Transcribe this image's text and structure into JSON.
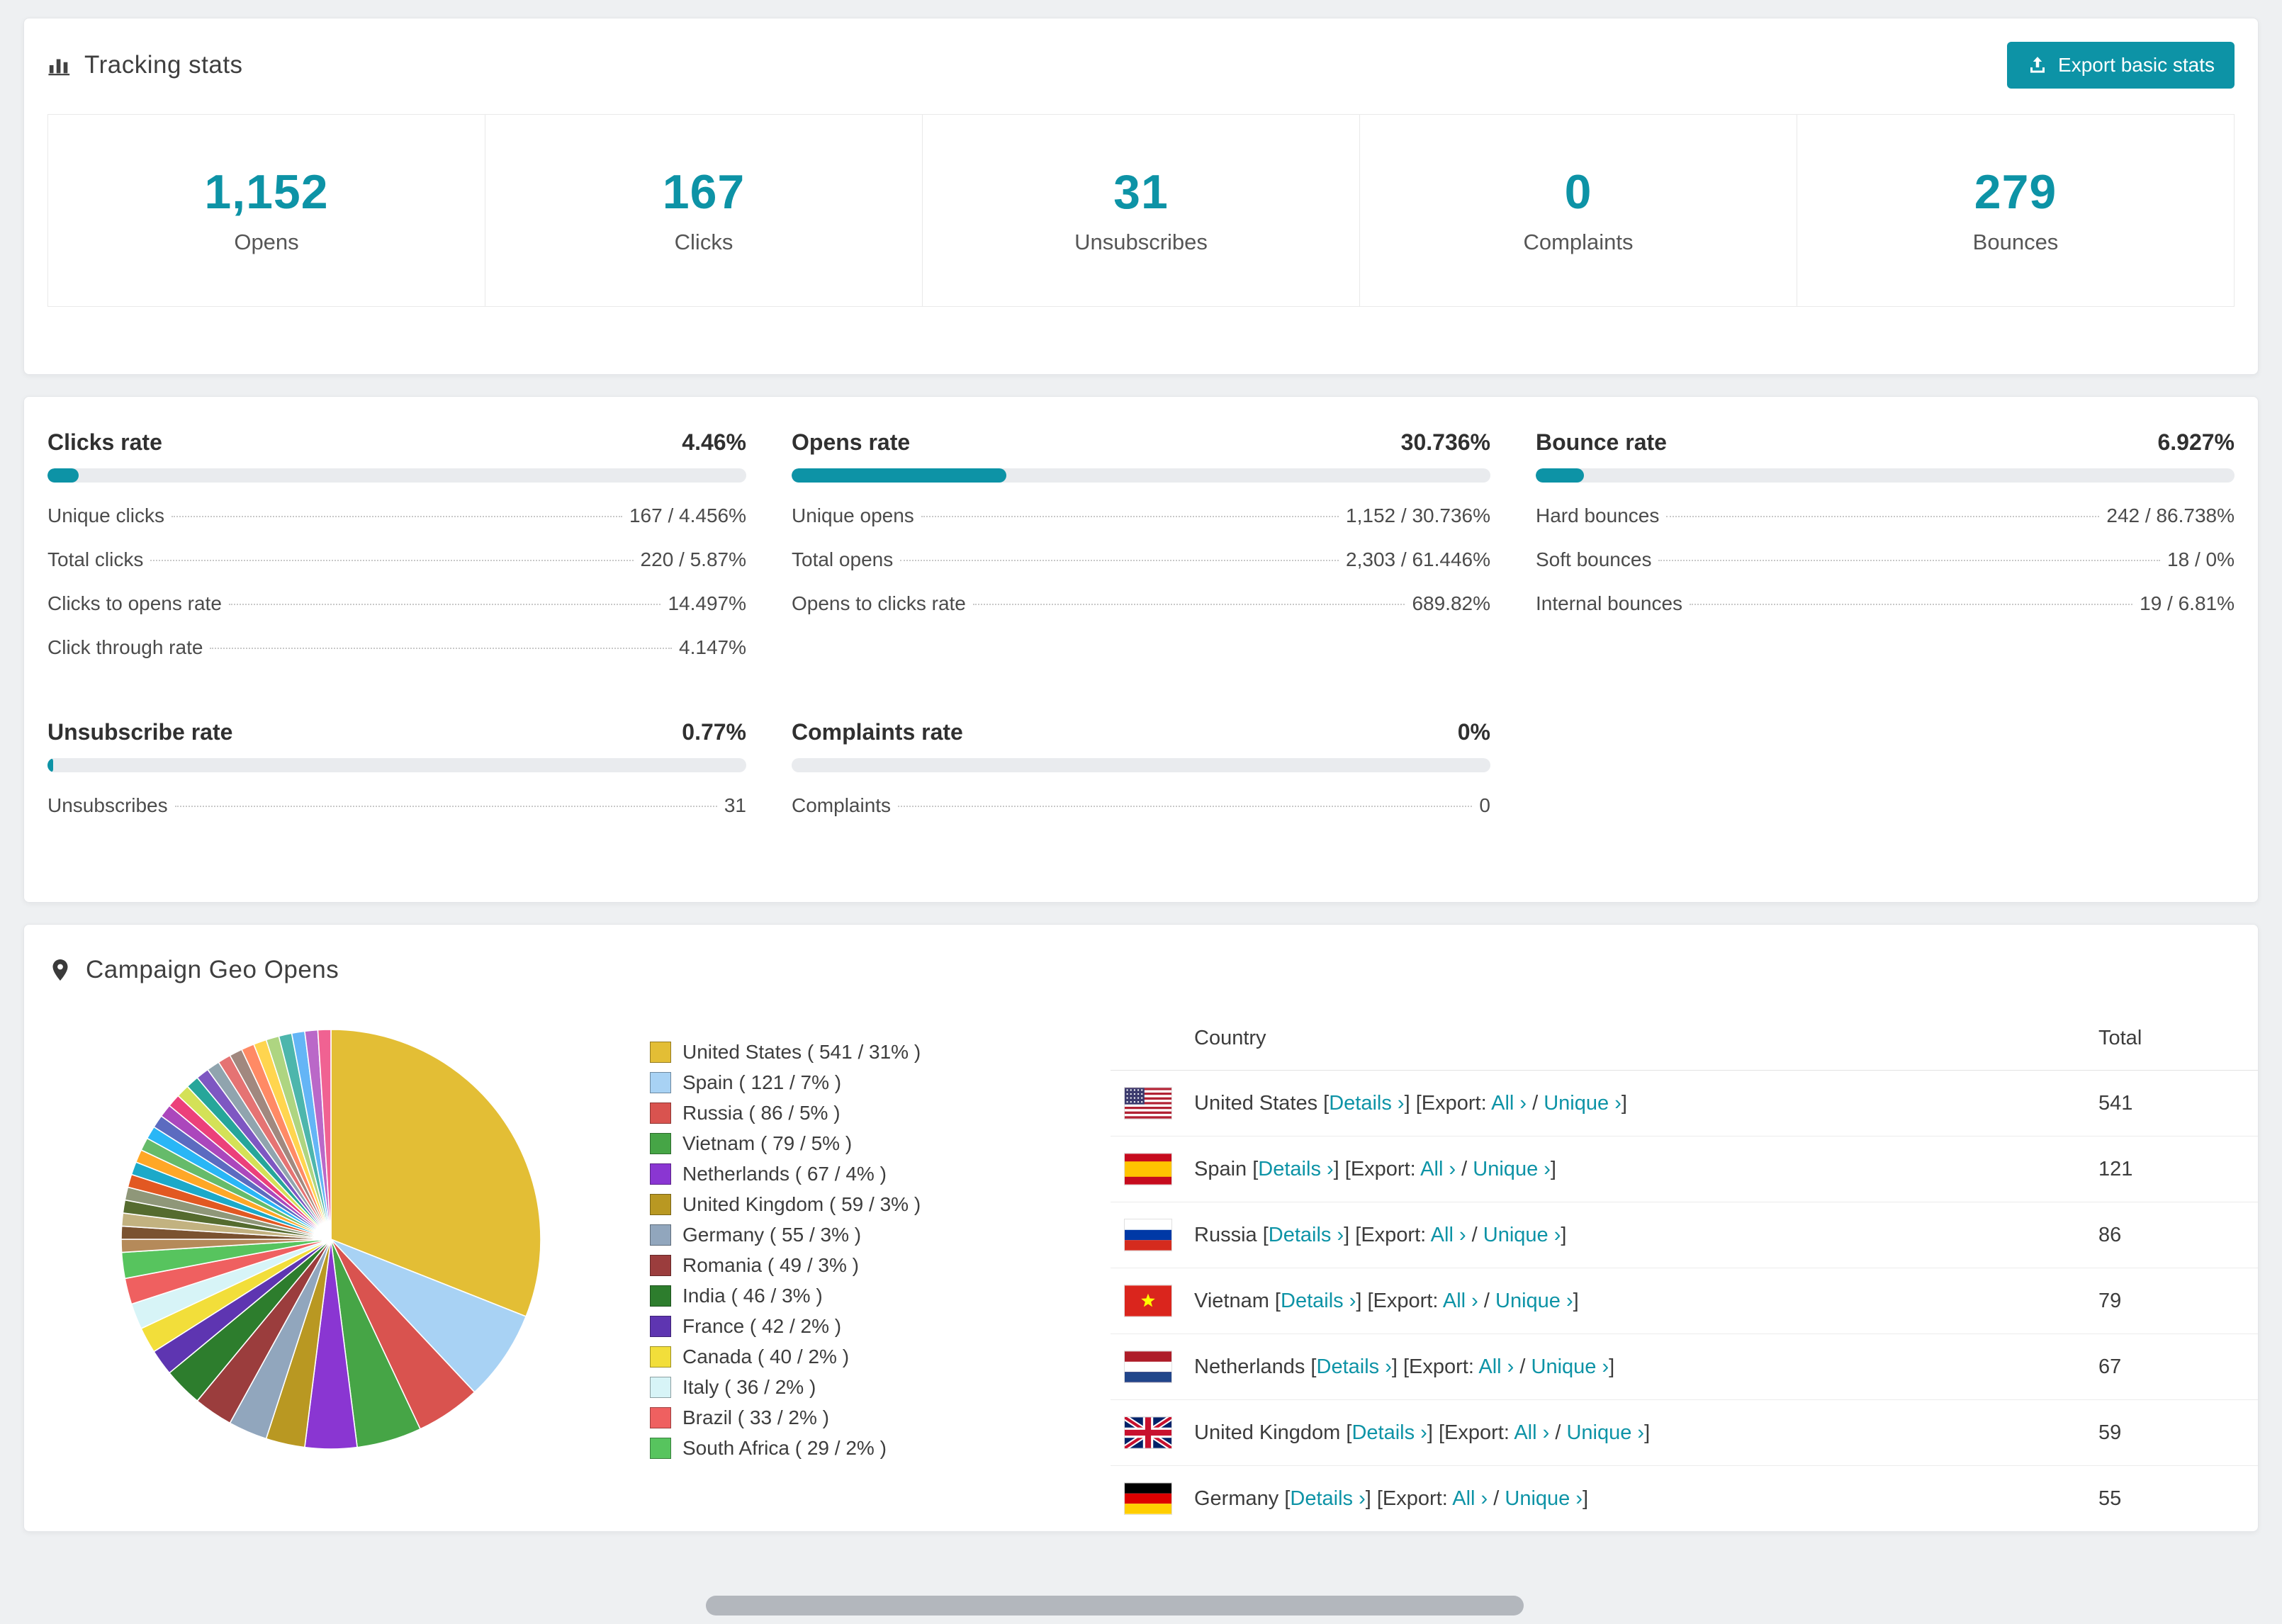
{
  "accent_color": "#0d93a6",
  "icons": {
    "header": "bar-chart-icon",
    "export": "export-icon",
    "geo": "map-pin-icon"
  },
  "tracking": {
    "title": "Tracking stats",
    "export_label": "Export basic stats",
    "stats": [
      {
        "value": "1,152",
        "label": "Opens"
      },
      {
        "value": "167",
        "label": "Clicks"
      },
      {
        "value": "31",
        "label": "Unsubscribes"
      },
      {
        "value": "0",
        "label": "Complaints"
      },
      {
        "value": "279",
        "label": "Bounces"
      }
    ]
  },
  "rates": [
    {
      "title": "Clicks rate",
      "percent": "4.46%",
      "fill": 4.46,
      "rows": [
        {
          "label": "Unique clicks",
          "value": "167 / 4.456%"
        },
        {
          "label": "Total clicks",
          "value": "220 / 5.87%"
        },
        {
          "label": "Clicks to opens rate",
          "value": "14.497%"
        },
        {
          "label": "Click through rate",
          "value": "4.147%"
        }
      ]
    },
    {
      "title": "Opens rate",
      "percent": "30.736%",
      "fill": 30.736,
      "rows": [
        {
          "label": "Unique opens",
          "value": "1,152 / 30.736%"
        },
        {
          "label": "Total opens",
          "value": "2,303 / 61.446%"
        },
        {
          "label": "Opens to clicks rate",
          "value": "689.82%"
        }
      ]
    },
    {
      "title": "Bounce rate",
      "percent": "6.927%",
      "fill": 6.927,
      "rows": [
        {
          "label": "Hard bounces",
          "value": "242 / 86.738%"
        },
        {
          "label": "Soft bounces",
          "value": "18 / 0%"
        },
        {
          "label": "Internal bounces",
          "value": "19 / 6.81%"
        }
      ]
    },
    {
      "title": "Unsubscribe rate",
      "percent": "0.77%",
      "fill": 0.77,
      "rows": [
        {
          "label": "Unsubscribes",
          "value": "31"
        }
      ]
    },
    {
      "title": "Complaints rate",
      "percent": "0%",
      "fill": 0,
      "rows": [
        {
          "label": "Complaints",
          "value": "0"
        }
      ]
    }
  ],
  "geo": {
    "title": "Campaign Geo Opens",
    "table": {
      "country_header": "Country",
      "total_header": "Total",
      "labels": {
        "details": "Details ›",
        "export": "Export:",
        "all": "All ›",
        "unique": "Unique ›"
      },
      "rows": [
        {
          "country": "United States",
          "total": "541",
          "flag": "us"
        },
        {
          "country": "Spain",
          "total": "121",
          "flag": "es"
        },
        {
          "country": "Russia",
          "total": "86",
          "flag": "ru"
        },
        {
          "country": "Vietnam",
          "total": "79",
          "flag": "vn"
        },
        {
          "country": "Netherlands",
          "total": "67",
          "flag": "nl"
        },
        {
          "country": "United Kingdom",
          "total": "59",
          "flag": "gb"
        },
        {
          "country": "Germany",
          "total": "55",
          "flag": "de"
        }
      ]
    }
  },
  "chart_data": {
    "type": "pie",
    "title": "Campaign Geo Opens",
    "legend_position": "right-of-pie",
    "slices": [
      {
        "label": "United States",
        "count": 541,
        "percent": 31,
        "color": "#e3be35"
      },
      {
        "label": "Spain",
        "count": 121,
        "percent": 7,
        "color": "#a8d2f4"
      },
      {
        "label": "Russia",
        "count": 86,
        "percent": 5,
        "color": "#d9534f"
      },
      {
        "label": "Vietnam",
        "count": 79,
        "percent": 5,
        "color": "#46a546"
      },
      {
        "label": "Netherlands",
        "count": 67,
        "percent": 4,
        "color": "#8a36d2"
      },
      {
        "label": "United Kingdom",
        "count": 59,
        "percent": 3,
        "color": "#b99822"
      },
      {
        "label": "Germany",
        "count": 55,
        "percent": 3,
        "color": "#91a6bd"
      },
      {
        "label": "Romania",
        "count": 49,
        "percent": 3,
        "color": "#9b3d3d"
      },
      {
        "label": "India",
        "count": 46,
        "percent": 3,
        "color": "#2d7d2d"
      },
      {
        "label": "France",
        "count": 42,
        "percent": 2,
        "color": "#5e35b1"
      },
      {
        "label": "Canada",
        "count": 40,
        "percent": 2,
        "color": "#f2de3a"
      },
      {
        "label": "Italy",
        "count": 36,
        "percent": 2,
        "color": "#d7f4f7"
      },
      {
        "label": "Brazil",
        "count": 33,
        "percent": 2,
        "color": "#ef6060"
      },
      {
        "label": "South Africa",
        "count": 29,
        "percent": 2,
        "color": "#57c45e"
      }
    ],
    "other_slices": {
      "percent_each": 1,
      "colors": [
        "#b58a5a",
        "#7a5230",
        "#c2b280",
        "#556b2f",
        "#8f9779",
        "#e25822",
        "#1ca9c9",
        "#ffa726",
        "#66bb6a",
        "#29b6f6",
        "#5c6bc0",
        "#ab47bc",
        "#ec407a",
        "#d4e157",
        "#26a69a",
        "#7e57c2",
        "#90a4ae",
        "#e57373",
        "#a1887f",
        "#ff8a65",
        "#ffd54f",
        "#aed581",
        "#4db6ac",
        "#64b5f6",
        "#ba68c8",
        "#f06292"
      ]
    }
  }
}
